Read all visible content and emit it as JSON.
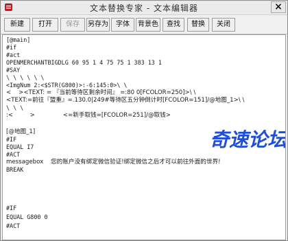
{
  "window": {
    "title": "文本替换专家 - 文本编辑器",
    "close_label": "×"
  },
  "toolbar": {
    "buttons": [
      {
        "label": "新建",
        "enabled": true
      },
      {
        "label": "打开",
        "enabled": true
      },
      {
        "label": "保存",
        "enabled": false
      },
      {
        "label": "另存为",
        "enabled": true
      },
      {
        "label": "字体",
        "enabled": true
      },
      {
        "label": "背景色",
        "enabled": true
      },
      {
        "label": "查找",
        "enabled": true
      },
      {
        "label": "替换",
        "enabled": true
      },
      {
        "label": "关闭",
        "enabled": true
      }
    ]
  },
  "editor": {
    "lines": [
      "[@main]",
      "#if",
      "#act",
      "OPENMERCHANTBIGDLG 60 95 1 4 75 75 1 383 13 1",
      "#SAY",
      "\\ \\ \\ \\ \\ \\",
      "<ImgNum 2:<$STR(G800)>:-6:145:0>\\ \\",
      "<    ><TEXT: = 『当前等待区剩余时间』 =:80 0[FCOLOR=250]>\\ \\",
      "<TEXT:=前往『盟重』=.130.0|249#等待区五分钟倒计时[FCOLOR=151]/@地图_1>\\ \\",
      "\\ \\ \\",
      ":<         >               <=新手取钱=[FCOLOR=251]/@取钱>",
      "",
      "[@地图_1]",
      "#IF",
      "EQUAL I7",
      "#ACT",
      "messagebox    您的账户没有绑定微信验证!绑定微信之后才可以前往外面的世界!",
      "BREAK",
      "",
      "",
      "",
      "#IF",
      "EQUAL G800 0",
      "#ACT"
    ]
  },
  "watermark": {
    "text": "奇速论坛"
  },
  "colors": {
    "watermark": "#1f4fd8",
    "title_icon": "#d0141f"
  }
}
